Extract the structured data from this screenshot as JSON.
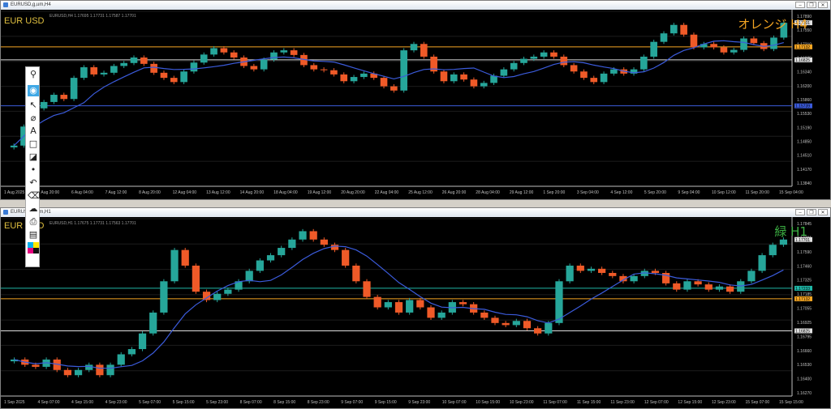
{
  "colors": {
    "up": "#26a69a",
    "down": "#ef5a28",
    "ma": "#3b5bdb",
    "orange": "#f5a623",
    "white": "#dddddd",
    "teal": "#1fb7a7",
    "grid": "#1c1c1c",
    "axis": "#c0c0c0",
    "green": "#3cb043"
  },
  "top": {
    "window_title": "EURUSD,g,um,H4",
    "symbol": "EUR USD",
    "label": "オレンジ H4",
    "ohlc": "EURUSD,H4  1.17695 1.17731 1.17587 1.17701",
    "price_ticks": [
      "1.17890",
      "1.17550",
      "1.17210",
      "1.16825",
      "1.16340",
      "1.16200",
      "1.15860",
      "1.15530",
      "1.15190",
      "1.14850",
      "1.14510",
      "1.14170",
      "1.13840"
    ],
    "price_tags": {
      "current": "1.17701",
      "orange": "1.17132",
      "white": "1.16825",
      "blue": "1.15739"
    },
    "time_ticks": [
      "1 Aug 2025",
      "4 Aug 20:00",
      "6 Aug 04:00",
      "7 Aug 12:00",
      "8 Aug 20:00",
      "12 Aug 04:00",
      "13 Aug 12:00",
      "14 Aug 20:00",
      "18 Aug 04:00",
      "19 Aug 12:00",
      "20 Aug 20:00",
      "22 Aug 04:00",
      "25 Aug 12:00",
      "26 Aug 20:00",
      "28 Aug 04:00",
      "29 Aug 12:00",
      "1 Sep 20:00",
      "3 Sep 04:00",
      "4 Sep 12:00",
      "5 Sep 20:00",
      "9 Sep 04:00",
      "10 Sep 12:00",
      "11 Sep 20:00",
      "15 Sep 04:00"
    ]
  },
  "bottom": {
    "window_title": "EURUSD,g,um,H1",
    "symbol": "EUR USD",
    "label": "緑 H1",
    "ohlc": "EURUSD,H1  1.17675 1.17731 1.17563 1.17701",
    "price_ticks": [
      "1.17845",
      "1.17701",
      "1.17590",
      "1.17460",
      "1.17325",
      "1.17185",
      "1.17055",
      "1.16925",
      "1.16795",
      "1.16660",
      "1.16530",
      "1.16400",
      "1.16270"
    ],
    "price_tags": {
      "current": "1.17701",
      "teal": "1.17233",
      "orange": "1.17132",
      "white": "1.16825"
    },
    "time_ticks": [
      "1 Sep 2025",
      "4 Sep 07:00",
      "4 Sep 15:00",
      "4 Sep 23:00",
      "5 Sep 07:00",
      "5 Sep 15:00",
      "5 Sep 23:00",
      "8 Sep 07:00",
      "8 Sep 15:00",
      "8 Sep 23:00",
      "9 Sep 07:00",
      "9 Sep 15:00",
      "9 Sep 23:00",
      "10 Sep 07:00",
      "10 Sep 15:00",
      "10 Sep 23:00",
      "11 Sep 07:00",
      "11 Sep 15:00",
      "11 Sep 23:00",
      "12 Sep 07:00",
      "12 Sep 15:00",
      "12 Sep 23:00",
      "15 Sep 07:00",
      "15 Sep 15:00"
    ]
  },
  "icons": [
    "pin-icon",
    "eye-icon",
    "cursor-icon",
    "crosshair-icon",
    "text-icon",
    "rectangle-icon",
    "ruler-icon",
    "dot-icon",
    "undo-icon",
    "trash-icon",
    "cloud-icon",
    "camera-icon",
    "clipboard-icon",
    "color-palette-icon"
  ],
  "window_buttons": {
    "minimize": "–",
    "restore": "❐",
    "close": "✕"
  },
  "chart_data": [
    {
      "type": "candlestick",
      "title": "EUR USD H4",
      "ylim": [
        1.1384,
        1.1797
      ],
      "annotations": [
        "オレンジ H4"
      ],
      "hlines": [
        {
          "value": 1.17132,
          "color": "orange"
        },
        {
          "value": 1.16825,
          "color": "white"
        },
        {
          "value": 1.15739,
          "color": "blue"
        }
      ],
      "close": [
        1.148,
        1.1525,
        1.1568,
        1.1583,
        1.16,
        1.159,
        1.164,
        1.1665,
        1.1648,
        1.1652,
        1.1668,
        1.1675,
        1.1688,
        1.1673,
        1.1652,
        1.164,
        1.163,
        1.1655,
        1.1676,
        1.1695,
        1.171,
        1.17,
        1.1688,
        1.1668,
        1.166,
        1.1683,
        1.17,
        1.1705,
        1.1694,
        1.167,
        1.166,
        1.1658,
        1.1648,
        1.1632,
        1.1642,
        1.165,
        1.164,
        1.162,
        1.161,
        1.1705,
        1.172,
        1.169,
        1.1655,
        1.1632,
        1.1648,
        1.1636,
        1.162,
        1.1628,
        1.1645,
        1.166,
        1.1675,
        1.1685,
        1.169,
        1.17,
        1.169,
        1.167,
        1.1655,
        1.164,
        1.163,
        1.165,
        1.166,
        1.165,
        1.166,
        1.169,
        1.1725,
        1.1745,
        1.1765,
        1.1742,
        1.1712,
        1.172,
        1.1712,
        1.17,
        1.1706,
        1.1733,
        1.1722,
        1.1708,
        1.1735,
        1.177
      ]
    },
    {
      "type": "candlestick",
      "title": "EUR USD H1",
      "ylim": [
        1.162,
        1.179
      ],
      "annotations": [
        "緑 H1"
      ],
      "hlines": [
        {
          "value": 1.17233,
          "color": "teal"
        },
        {
          "value": 1.17132,
          "color": "orange"
        },
        {
          "value": 1.16825,
          "color": "white"
        }
      ],
      "close": [
        1.1655,
        1.165,
        1.1648,
        1.1655,
        1.1645,
        1.164,
        1.1645,
        1.165,
        1.164,
        1.165,
        1.166,
        1.1665,
        1.168,
        1.17,
        1.173,
        1.176,
        1.1745,
        1.172,
        1.1712,
        1.1718,
        1.1722,
        1.173,
        1.174,
        1.175,
        1.1755,
        1.1762,
        1.177,
        1.1778,
        1.177,
        1.1765,
        1.176,
        1.1745,
        1.173,
        1.1715,
        1.1705,
        1.171,
        1.17,
        1.1712,
        1.1705,
        1.1695,
        1.17,
        1.171,
        1.1708,
        1.17,
        1.1695,
        1.169,
        1.1688,
        1.1692,
        1.1685,
        1.168,
        1.169,
        1.173,
        1.1745,
        1.174,
        1.1742,
        1.1738,
        1.1735,
        1.173,
        1.1735,
        1.174,
        1.1738,
        1.1728,
        1.1722,
        1.173,
        1.1727,
        1.1722,
        1.1725,
        1.172,
        1.173,
        1.174,
        1.1755,
        1.1765,
        1.177
      ]
    }
  ]
}
